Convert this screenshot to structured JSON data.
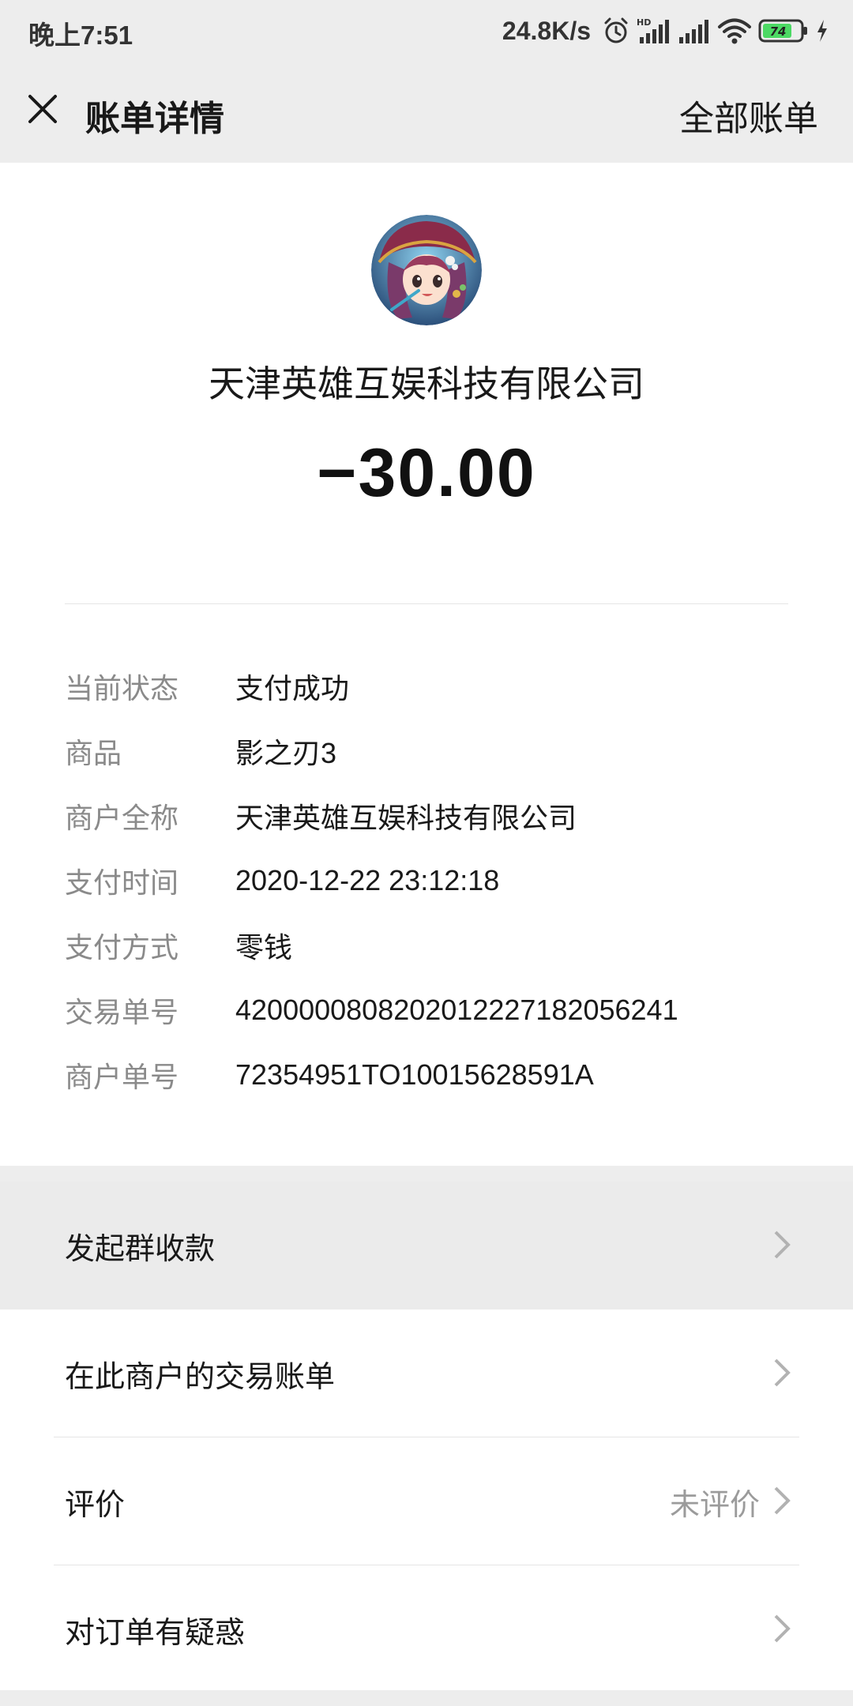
{
  "status_bar": {
    "time": "晚上7:51",
    "net_speed": "24.8K/s",
    "battery": "74",
    "icons": [
      "alarm-icon",
      "hd-signal-icon",
      "signal-icon",
      "wifi-icon",
      "battery-icon",
      "charging-icon"
    ]
  },
  "nav": {
    "title": "账单详情",
    "right_link": "全部账单",
    "close_icon": "close-icon"
  },
  "bill": {
    "merchant_name": "天津英雄互娱科技有限公司",
    "amount": "−30.00",
    "details": [
      {
        "label": "当前状态",
        "value": "支付成功"
      },
      {
        "label": "商品",
        "value": "影之刃3"
      },
      {
        "label": "商户全称",
        "value": "天津英雄互娱科技有限公司"
      },
      {
        "label": "支付时间",
        "value": "2020-12-22 23:12:18"
      },
      {
        "label": "支付方式",
        "value": "零钱"
      },
      {
        "label": "交易单号",
        "value": "4200000808202012227182056241"
      },
      {
        "label": "商户单号",
        "value": "72354951TO10015628591A"
      }
    ]
  },
  "menu": {
    "items": [
      {
        "label": "发起群收款",
        "extra": ""
      },
      {
        "label": "在此商户的交易账单",
        "extra": ""
      },
      {
        "label": "评价",
        "extra": "未评价"
      },
      {
        "label": "对订单有疑惑",
        "extra": ""
      }
    ]
  },
  "colors": {
    "background": "#ededed",
    "card": "#ffffff",
    "label_gray": "#8a8a8a",
    "pressed": "#ebebeb",
    "battery_green": "#4cd964"
  }
}
